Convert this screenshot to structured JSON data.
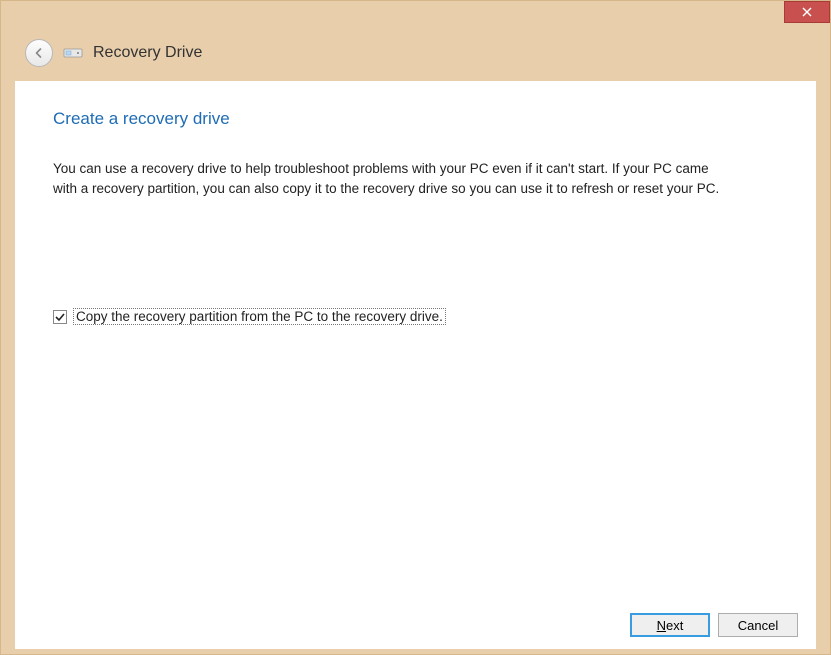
{
  "window": {
    "title": "Recovery Drive"
  },
  "page": {
    "heading": "Create a recovery drive",
    "description": "You can use a recovery drive to help troubleshoot problems with your PC even if it can't start. If your PC came with a recovery partition, you can also copy it to the recovery drive so you can use it to refresh or reset your PC."
  },
  "checkbox": {
    "label": "Copy the recovery partition from the PC to the recovery drive.",
    "checked": true
  },
  "buttons": {
    "next": "Next",
    "cancel": "Cancel"
  }
}
